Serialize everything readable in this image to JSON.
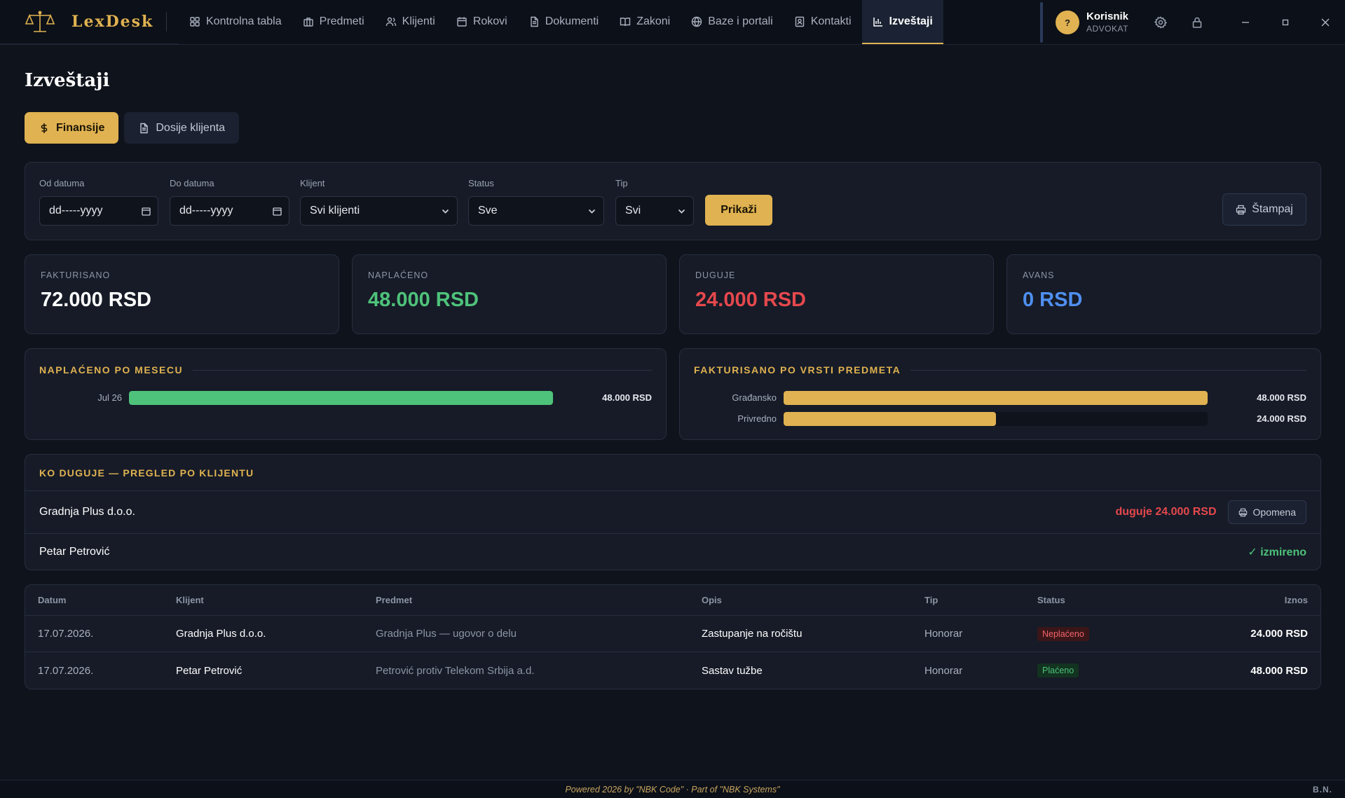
{
  "app": {
    "brand": "LexDesk"
  },
  "nav": {
    "items": [
      {
        "label": "Kontrolna tabla"
      },
      {
        "label": "Predmeti"
      },
      {
        "label": "Klijenti"
      },
      {
        "label": "Rokovi"
      },
      {
        "label": "Dokumenti"
      },
      {
        "label": "Zakoni"
      },
      {
        "label": "Baze i portali"
      },
      {
        "label": "Kontakti"
      },
      {
        "label": "Izveštaji"
      }
    ],
    "active": "Izveštaji"
  },
  "user": {
    "initial": "?",
    "name": "Korisnik",
    "role": "ADVOKAT"
  },
  "page": {
    "title": "Izveštaji"
  },
  "tabs": {
    "finance": "Finansije",
    "dossier": "Dosije klijenta"
  },
  "filters": {
    "from_label": "Od datuma",
    "from_value": "dd-----yyyy",
    "to_label": "Do datuma",
    "to_value": "dd-----yyyy",
    "client_label": "Klijent",
    "client_value": "Svi klijenti",
    "status_label": "Status",
    "status_value": "Sve",
    "type_label": "Tip",
    "type_value": "Svi",
    "show_button": "Prikaži",
    "print_button": "Štampaj"
  },
  "stats": [
    {
      "label": "FAKTURISANO",
      "value": "72.000 RSD",
      "color": "#ffffff"
    },
    {
      "label": "NAPLAĆENO",
      "value": "48.000 RSD",
      "color": "#4ec27a"
    },
    {
      "label": "DUGUJE",
      "value": "24.000 RSD",
      "color": "#e5484d"
    },
    {
      "label": "AVANS",
      "value": "0 RSD",
      "color": "#4f8ff0"
    }
  ],
  "chart_data": [
    {
      "type": "bar",
      "title": "NAPLAĆENO PO MESECU",
      "categories": [
        "Jul 26"
      ],
      "values": [
        48000
      ],
      "value_labels": [
        "48.000 RSD"
      ],
      "max": 48000,
      "color": "#4ec27a"
    },
    {
      "type": "bar",
      "title": "FAKTURISANO PO VRSTI PREDMETA",
      "categories": [
        "Građansko",
        "Privredno"
      ],
      "values": [
        48000,
        24000
      ],
      "value_labels": [
        "48.000 RSD",
        "24.000 RSD"
      ],
      "max": 48000,
      "color": "#e0b251"
    }
  ],
  "debts": {
    "title": "KO DUGUJE — PREGLED PO KLIJENTU",
    "rows": [
      {
        "client": "Gradnja Plus d.o.o.",
        "status": "duguje 24.000 RSD",
        "action": "Opomena"
      },
      {
        "client": "Petar Petrović",
        "status": "✓ izmireno"
      }
    ]
  },
  "table": {
    "headers": [
      "Datum",
      "Klijent",
      "Predmet",
      "Opis",
      "Tip",
      "Status",
      "Iznos"
    ],
    "rows": [
      {
        "date": "17.07.2026.",
        "client": "Gradnja Plus d.o.o.",
        "case": "Gradnja Plus — ugovor o delu",
        "desc": "Zastupanje na ročištu",
        "type": "Honorar",
        "status": "Neplaćeno",
        "amount": "24.000 RSD"
      },
      {
        "date": "17.07.2026.",
        "client": "Petar Petrović",
        "case": "Petrović protiv Telekom Srbija a.d.",
        "desc": "Sastav tužbe",
        "type": "Honorar",
        "status": "Plaćeno",
        "amount": "48.000 RSD"
      }
    ]
  },
  "footer": {
    "text": "Powered 2026 by \"NBK Code\" · Part of \"NBK Systems\"",
    "initials": "B.N."
  }
}
